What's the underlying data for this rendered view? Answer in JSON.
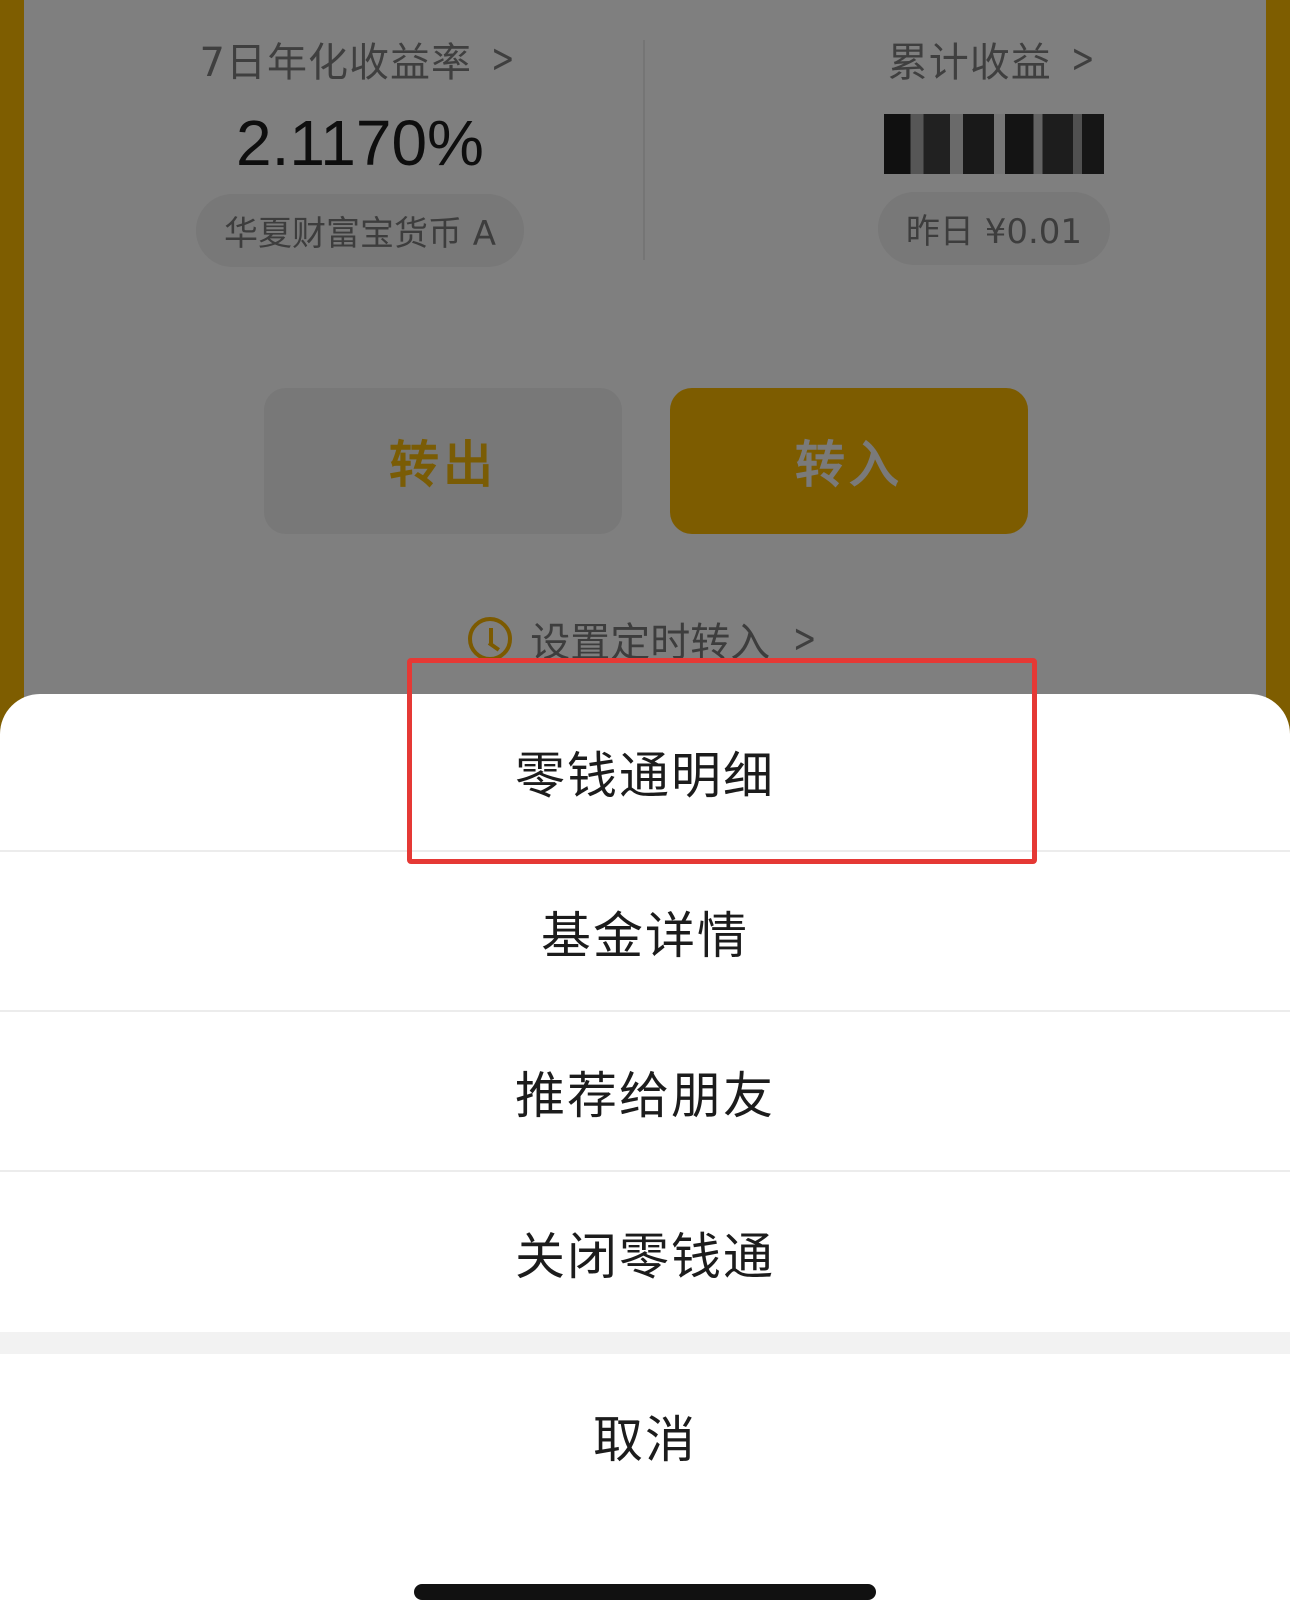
{
  "background": {
    "yield": {
      "label": "7日年化收益率",
      "value": "2.1170%",
      "fund_name": "华夏财富宝货币 A"
    },
    "total": {
      "label": "累计收益",
      "yesterday": "昨日 ¥0.01"
    },
    "buttons": {
      "transfer_out": "转出",
      "transfer_in": "转入"
    },
    "timer_link": "设置定时转入"
  },
  "sheet": {
    "items": [
      "零钱通明细",
      "基金详情",
      "推荐给朋友",
      "关闭零钱通"
    ],
    "cancel": "取消"
  },
  "colors": {
    "gold": "#7e5d00",
    "highlight": "#e53935"
  }
}
